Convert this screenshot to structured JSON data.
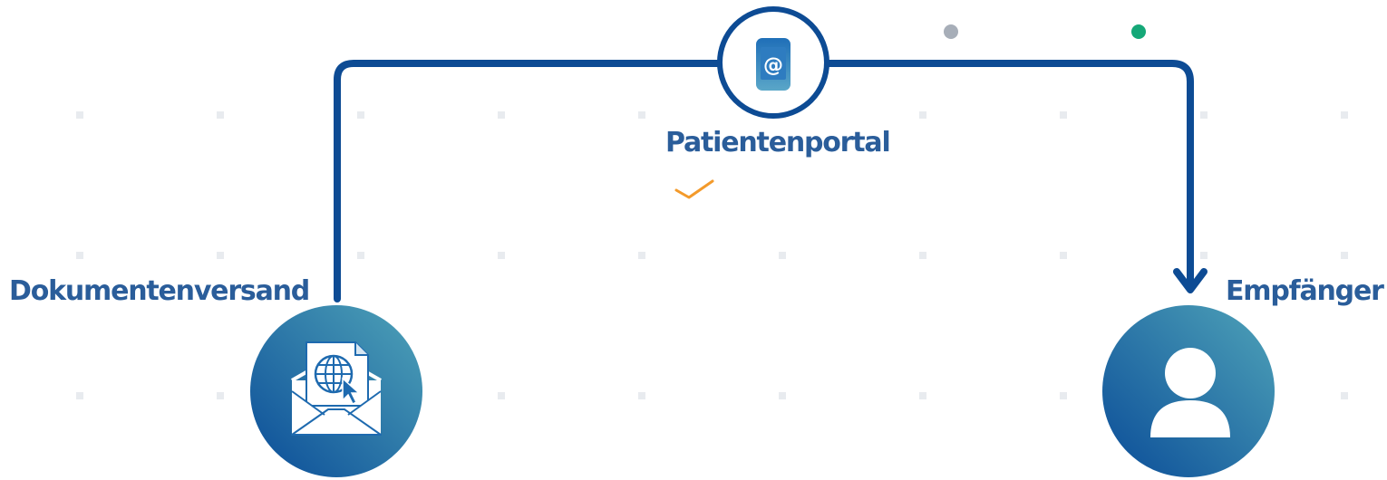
{
  "nodes": {
    "source": {
      "label": "Dokumentenversand",
      "icon": "envelope-globe-icon"
    },
    "channel": {
      "label": "Patientenportal",
      "icon": "smartphone-at-icon"
    },
    "recipient": {
      "label": "Empfänger",
      "icon": "user-icon"
    }
  },
  "status": {
    "icon": "checkmark-icon",
    "color": "#f39a2b"
  },
  "indicators": [
    {
      "name": "gray-dot",
      "color": "#a7aeb8"
    },
    {
      "name": "green-dot",
      "color": "#15a878"
    }
  ],
  "colors": {
    "line": "#0d4b94",
    "gradient_dark": "#0a4c98",
    "gradient_light": "#4fa3b8",
    "label": "#2a5d9a",
    "grid_dot": "#e8ebef"
  }
}
